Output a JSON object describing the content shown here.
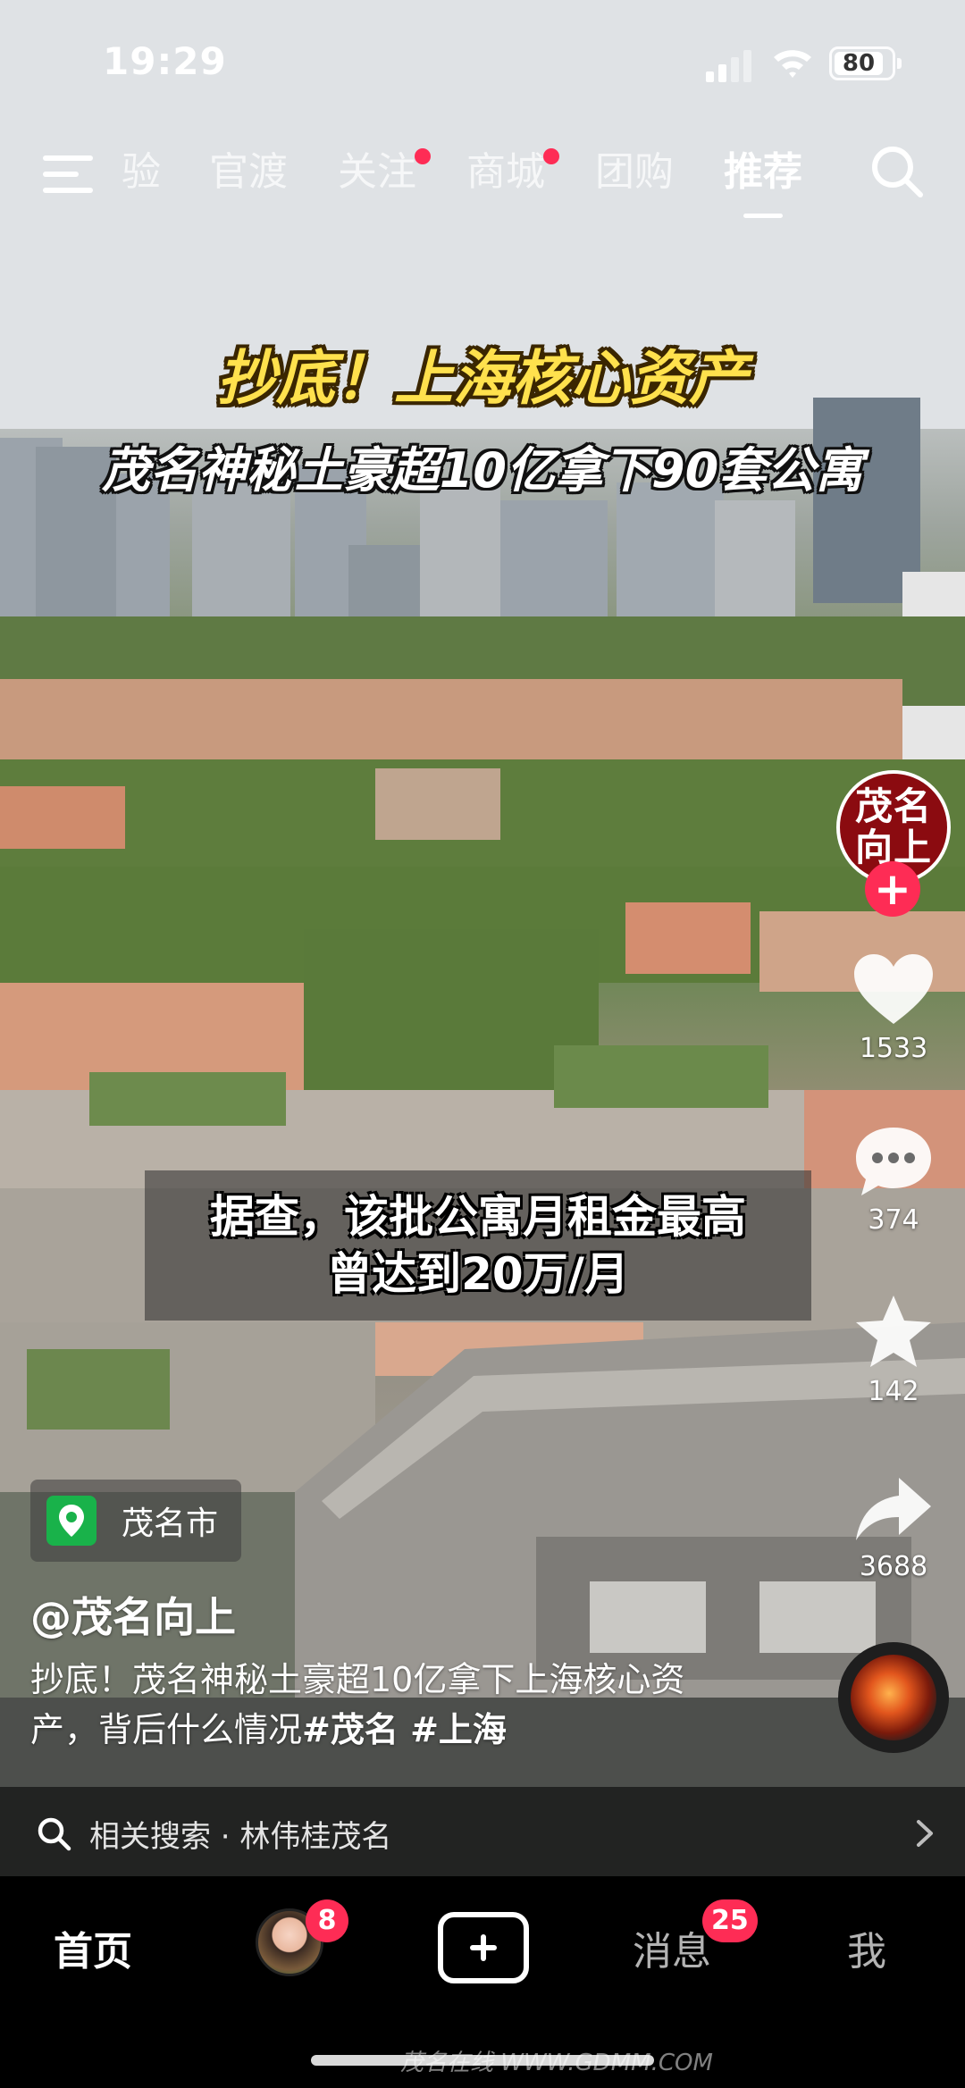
{
  "status_bar": {
    "time": "19:29",
    "battery": "80"
  },
  "top_nav": {
    "tabs": [
      {
        "label": "验",
        "dot": false
      },
      {
        "label": "官渡",
        "dot": false
      },
      {
        "label": "关注",
        "dot": true
      },
      {
        "label": "商城",
        "dot": true
      },
      {
        "label": "团购",
        "dot": false
      },
      {
        "label": "推荐",
        "dot": false,
        "active": true
      }
    ]
  },
  "video": {
    "title": "抄底！上海核心资产",
    "subtitle": "茂名神秘土豪超10亿拿下90套公寓",
    "caption_line1": "据查，该批公寓月租金最高",
    "caption_line2": "曾达到20万/月"
  },
  "actions": {
    "avatar_line1": "茂名",
    "avatar_line2": "向上",
    "follow": "+",
    "likes": "1533",
    "comments": "374",
    "favorites": "142",
    "shares": "3688"
  },
  "info": {
    "location": "茂名市",
    "author": "@茂名向上",
    "description": "抄底！茂名神秘土豪超10亿拿下上海核心资产，背后什么情况",
    "hashtags": "#茂名 #上海"
  },
  "related": {
    "text": "相关搜索 · 林伟桂茂名"
  },
  "bottom_nav": {
    "home": "首页",
    "friend_badge": "8",
    "messages": "消息",
    "messages_badge": "25",
    "me": "我",
    "watermark": "茂名在线 WWW.GDMM.COM"
  },
  "colors": {
    "accent": "#fe2c55",
    "title_yellow": "#ffe14d",
    "location_green": "#19b24a",
    "avatar_red": "#8b0b10"
  },
  "icons": [
    "menu-icon",
    "search-icon",
    "signal-icon",
    "wifi-icon",
    "battery-icon",
    "heart-icon",
    "comment-icon",
    "star-icon",
    "share-icon",
    "location-pin-icon",
    "chevron-right-icon",
    "plus-icon"
  ]
}
